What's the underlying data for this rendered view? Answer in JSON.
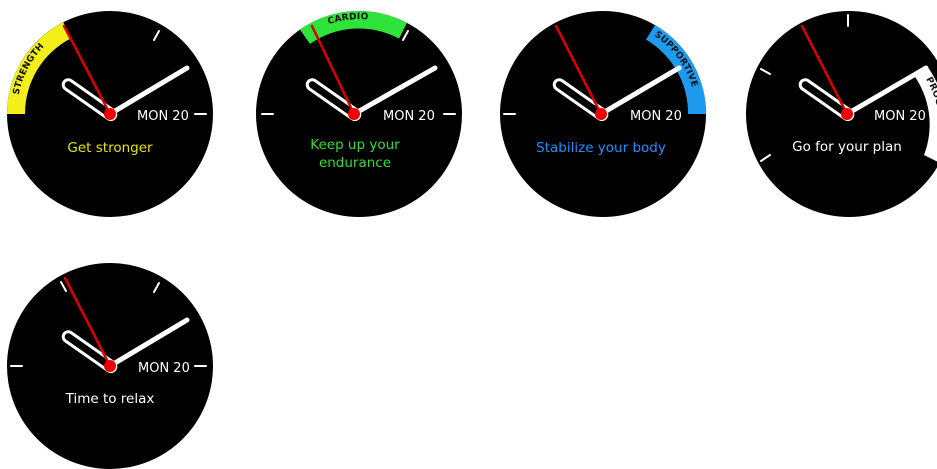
{
  "watch_faces": [
    {
      "date": "MON 20",
      "message_lines": [
        "Get stronger"
      ],
      "message_color": "#e6e600",
      "badge": {
        "label": "STRENGTH",
        "color": "#f2ef1a",
        "position": "left"
      }
    },
    {
      "date": "MON 20",
      "message_lines": [
        "Keep up your",
        "endurance"
      ],
      "message_color": "#33dd33",
      "badge": {
        "label": "CARDIO",
        "color": "#2fe33a",
        "position": "top"
      }
    },
    {
      "date": "MON 20",
      "message_lines": [
        "Stabilize your body"
      ],
      "message_color": "#1e90ff",
      "badge": {
        "label": "SUPPORTIVE",
        "color": "#1e9bef",
        "position": "right"
      }
    },
    {
      "date": "MON 20",
      "message_lines": [
        "Go for your plan"
      ],
      "message_color": "#ffffff",
      "badge": {
        "label": "PROGRAM",
        "color": "#ffffff",
        "position": "right-lower"
      }
    },
    {
      "date": "MON 20",
      "message_lines": [
        "Time to relax"
      ],
      "message_color": "#ffffff",
      "badge": null
    }
  ],
  "colors": {
    "face": "#000000",
    "hands": "#ffffff",
    "second_hand": "#dd0000",
    "center_dot": "#ee0000"
  }
}
